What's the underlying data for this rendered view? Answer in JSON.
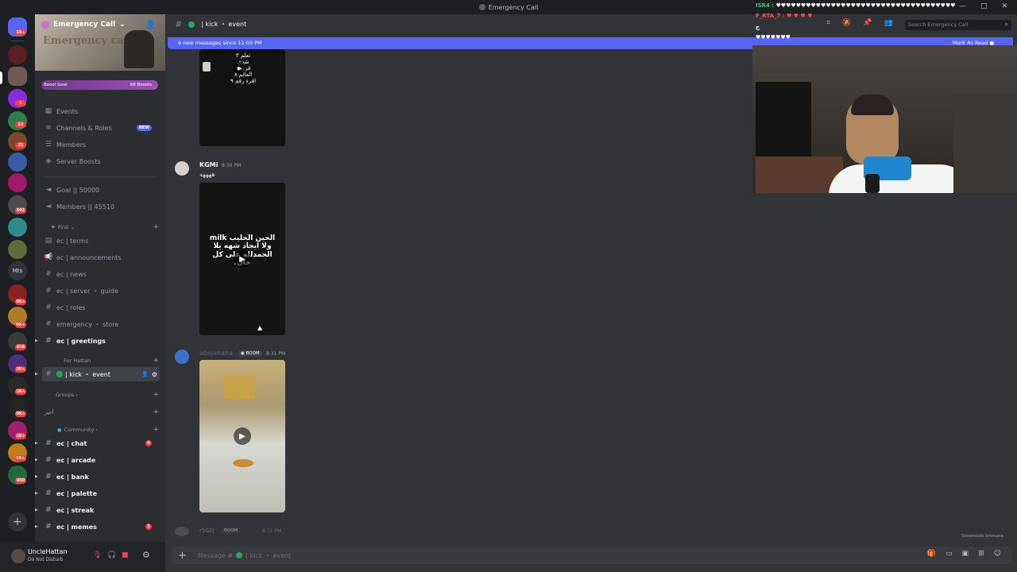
{
  "window": {
    "title": "Emergency Call"
  },
  "server": {
    "name": "Emergency Call",
    "banner_text": "Emergency call",
    "boost_goal": "Boost Goal",
    "boost_count": "66 Boosts"
  },
  "server_rail": {
    "badges": [
      "1K+",
      "1",
      "22",
      "22",
      "502",
      "Mts",
      "9K+",
      "9K+",
      "416",
      "3K+",
      "1K+",
      "9K+",
      "1K+",
      "1K+",
      "660"
    ]
  },
  "sidebar": {
    "items": [
      {
        "label": "Events",
        "icon": "calendar-icon"
      },
      {
        "label": "Channels & Roles",
        "icon": "list-icon",
        "badge": "NEW"
      },
      {
        "label": "Members",
        "icon": "members-icon"
      },
      {
        "label": "Server Boosts",
        "icon": "boost-icon"
      },
      {
        "label": "Goal || 50000",
        "icon": "voice-icon"
      },
      {
        "label": "Members || 45510",
        "icon": "voice-icon"
      }
    ],
    "categories": {
      "first": "First",
      "for_hattan": "For Hattan",
      "groups": "Groups",
      "aslam": "أجير",
      "community": "Community"
    },
    "first_channels": [
      {
        "label": "ec | terms",
        "icon": "rules-icon"
      },
      {
        "label": "ec | announcements",
        "icon": "announcement-icon"
      },
      {
        "label": "ec | news",
        "icon": "hash-icon"
      },
      {
        "label": "ec | server ・ guide",
        "icon": "hash-icon"
      },
      {
        "label": "ec | roles",
        "icon": "hash-icon"
      },
      {
        "label": "emergency ・ store",
        "icon": "hash-icon"
      },
      {
        "label": "ec | greetings",
        "icon": "hash-icon"
      }
    ],
    "active_channel": "| kick ・ event",
    "community_channels": [
      {
        "label": "ec | chat",
        "badge": "4"
      },
      {
        "label": "ec | arcade",
        "badge": ""
      },
      {
        "label": "ec | bank",
        "badge": ""
      },
      {
        "label": "ec | palette",
        "badge": ""
      },
      {
        "label": "ec | streak",
        "badge": ""
      },
      {
        "label": "ec | memes",
        "badge": "1"
      }
    ]
  },
  "user": {
    "name": "UncleHattan",
    "status": "Do Not Disturb"
  },
  "chat": {
    "channel_name": "| kick ・ event",
    "search_placeholder": "Search Emergency Call",
    "new_messages_text": "6 new messages since 11:03 PM",
    "mark_as_read": "Mark As Read",
    "composer_placeholder": "Message #",
    "slowmode": "Slowmode Immune"
  },
  "messages": [
    {
      "author": "",
      "time": "",
      "text": "",
      "video_text": "تعلم ٣\nشدي\nقرن ٧\nالعالم ٨\nاقرء رقم ٩"
    },
    {
      "author": "KGMi",
      "time": "8:30 PM",
      "text": "ههههه",
      "video_text": "الحين الحليب milk\nولا ايجاد شهه يلا\nالحمدلله على كل\nحال."
    },
    {
      "author": "abojanaha",
      "tag": "BOOM",
      "time": "8:31 PM",
      "text": ""
    },
    {
      "author": "r502|",
      "tag": "BOOM",
      "time": "8:31 PM"
    }
  ],
  "overlay_chat": [
    {
      "name": "ISR4 :",
      "text": "♥♥♥♥♥♥♥♥♥♥♥♥♥♥♥♥♥♥♥♥♥♥♥♥♥♥♥♥♥♥♥♥♥♥♥♥"
    },
    {
      "name": "F_RTA_7 :",
      "text": "♥ ♥ ♥ ♥"
    },
    {
      "name": "",
      "text": "ج"
    },
    {
      "name": "",
      "text": "♥♥♥♥♥♥♥"
    }
  ],
  "colors": {
    "blurple": "#5865f2",
    "online": "#23a55a",
    "dnd": "#f23f43"
  }
}
